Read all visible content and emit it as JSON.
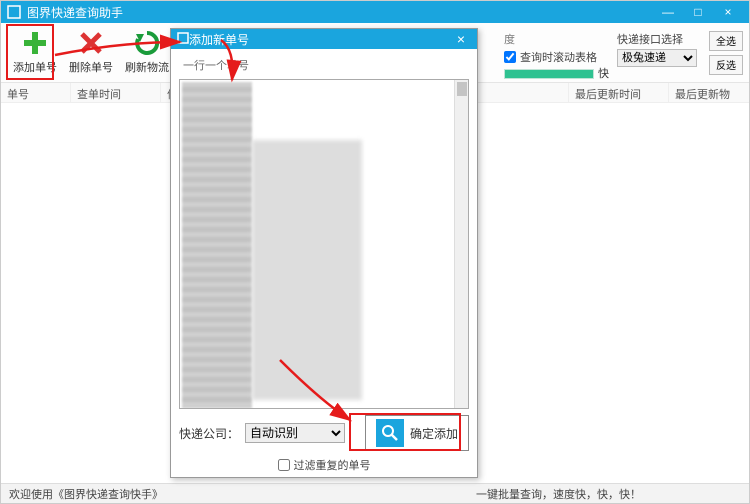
{
  "window": {
    "title": "图界快递查询助手",
    "min_icon": "—",
    "max_icon": "□",
    "close_icon": "×"
  },
  "toolbar": {
    "add_label": "添加单号",
    "delete_label": "删除单号",
    "refresh_label": "刷新物流",
    "progress_title": "度",
    "checkbox_label": "查询时滚动表格",
    "progress_text": "快",
    "iface_label": "快递接口选择",
    "iface_option": "极兔速递",
    "select_all": "全选",
    "invert_sel": "反选"
  },
  "columns": {
    "c1": "单号",
    "c2": "查单时间",
    "c3": "信息",
    "c4": "最后更新时间",
    "c5": "最后更新物"
  },
  "modal": {
    "title": "添加新单号",
    "hint": "一行一个单号",
    "company_label": "快递公司：",
    "company_option": "自动识别",
    "confirm_label": "确定添加",
    "filter_label": "过滤重复的单号"
  },
  "status": {
    "left": "欢迎使用《图界快递查询快手》",
    "right": "一键批量查询，速度快，快，快！"
  }
}
